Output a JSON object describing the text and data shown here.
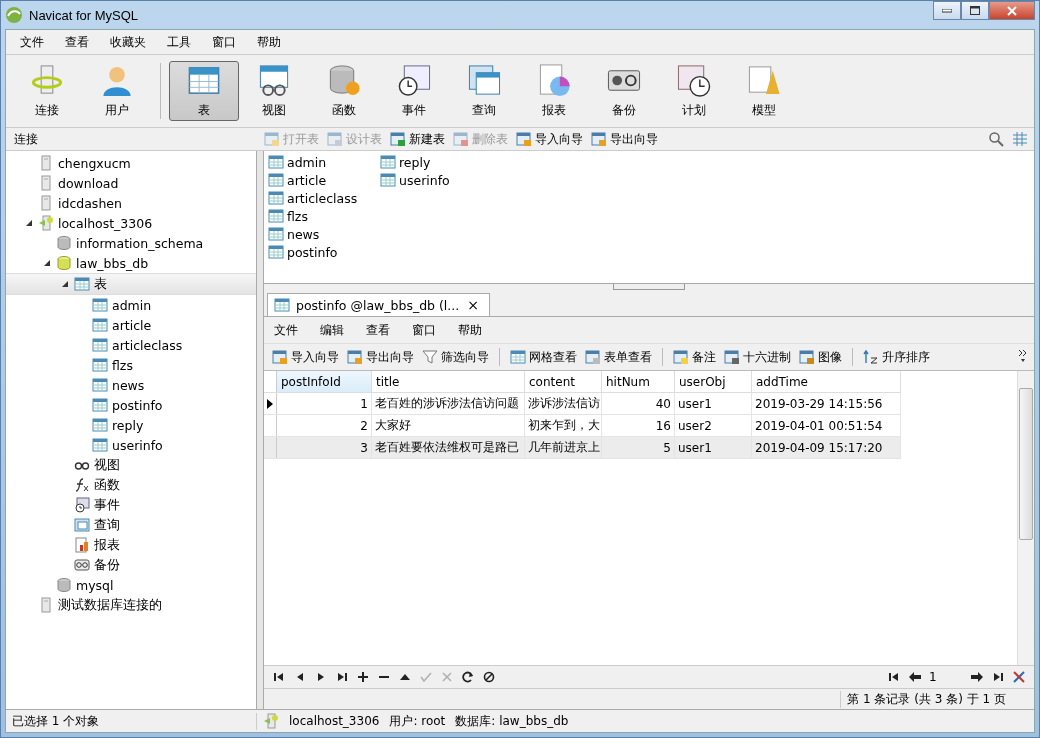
{
  "window": {
    "title": "Navicat for MySQL"
  },
  "menu": [
    "文件",
    "查看",
    "收藏夹",
    "工具",
    "窗口",
    "帮助"
  ],
  "toolbar": [
    {
      "kind": "connection",
      "label": "连接",
      "selected": false
    },
    {
      "kind": "user",
      "label": "用户",
      "selected": false
    },
    {
      "kind": "table",
      "label": "表",
      "selected": true
    },
    {
      "kind": "view",
      "label": "视图",
      "selected": false
    },
    {
      "kind": "function",
      "label": "函数",
      "selected": false
    },
    {
      "kind": "event",
      "label": "事件",
      "selected": false
    },
    {
      "kind": "query",
      "label": "查询",
      "selected": false
    },
    {
      "kind": "report",
      "label": "报表",
      "selected": false
    },
    {
      "kind": "backup",
      "label": "备份",
      "selected": false
    },
    {
      "kind": "schedule",
      "label": "计划",
      "selected": false
    },
    {
      "kind": "model",
      "label": "模型",
      "selected": false
    }
  ],
  "pane_label": "连接",
  "object_actions": [
    {
      "kind": "open",
      "label": "打开表",
      "disabled": true
    },
    {
      "kind": "design",
      "label": "设计表",
      "disabled": true
    },
    {
      "kind": "new",
      "label": "新建表",
      "disabled": false
    },
    {
      "kind": "delete",
      "label": "删除表",
      "disabled": true
    },
    {
      "kind": "import",
      "label": "导入向导",
      "disabled": false
    },
    {
      "kind": "export",
      "label": "导出向导",
      "disabled": false
    }
  ],
  "tree": [
    {
      "kind": "connection",
      "label": "chengxucm",
      "selected": false
    },
    {
      "kind": "connection",
      "label": "download",
      "selected": false
    },
    {
      "kind": "connection",
      "label": "idcdashen",
      "selected": false
    },
    {
      "kind": "connection-open",
      "label": "localhost_3306",
      "expanded": true,
      "selected": false,
      "children": [
        {
          "kind": "schema",
          "label": "information_schema",
          "selected": false
        },
        {
          "kind": "db-open",
          "label": "law_bbs_db",
          "expanded": true,
          "selected": false,
          "children": [
            {
              "kind": "table-folder",
              "label": "表",
              "expanded": true,
              "selected": true,
              "children": [
                {
                  "kind": "table",
                  "label": "admin",
                  "selected": false
                },
                {
                  "kind": "table",
                  "label": "article",
                  "selected": false
                },
                {
                  "kind": "table",
                  "label": "articleclass",
                  "selected": false
                },
                {
                  "kind": "table",
                  "label": "flzs",
                  "selected": false
                },
                {
                  "kind": "table",
                  "label": "news",
                  "selected": false
                },
                {
                  "kind": "table",
                  "label": "postinfo",
                  "selected": false
                },
                {
                  "kind": "table",
                  "label": "reply",
                  "selected": false
                },
                {
                  "kind": "table",
                  "label": "userinfo",
                  "selected": false
                }
              ]
            },
            {
              "kind": "view",
              "label": "视图",
              "selected": false
            },
            {
              "kind": "function",
              "label": "函数",
              "selected": false
            },
            {
              "kind": "event",
              "label": "事件",
              "selected": false
            },
            {
              "kind": "query",
              "label": "查询",
              "selected": false
            },
            {
              "kind": "report",
              "label": "报表",
              "selected": false
            },
            {
              "kind": "backup",
              "label": "备份",
              "selected": false
            }
          ]
        },
        {
          "kind": "schema",
          "label": "mysql",
          "selected": false
        }
      ]
    },
    {
      "kind": "connection",
      "label": "测试数据库连接的",
      "selected": false
    }
  ],
  "objects": [
    "admin",
    "article",
    "articleclass",
    "flzs",
    "news",
    "postinfo",
    "reply",
    "userinfo"
  ],
  "editor_tab": {
    "title": "postinfo @law_bbs_db (l...",
    "close": "×"
  },
  "editor_menu": [
    "文件",
    "编辑",
    "查看",
    "窗口",
    "帮助"
  ],
  "editor_toolbar": [
    {
      "kind": "import",
      "label": "导入向导"
    },
    {
      "kind": "export",
      "label": "导出向导"
    },
    {
      "kind": "filter",
      "label": "筛选向导"
    },
    {
      "kind": "separator"
    },
    {
      "kind": "grid",
      "label": "网格查看"
    },
    {
      "kind": "form",
      "label": "表单查看"
    },
    {
      "kind": "separator"
    },
    {
      "kind": "memo",
      "label": "备注"
    },
    {
      "kind": "hex",
      "label": "十六进制"
    },
    {
      "kind": "image",
      "label": "图像"
    },
    {
      "kind": "separator"
    },
    {
      "kind": "sort",
      "label": "升序排序"
    }
  ],
  "table": {
    "columns": [
      {
        "label": "postInfoId",
        "kind": "number",
        "selected": true
      },
      {
        "label": "title",
        "kind": "text",
        "selected": false
      },
      {
        "label": "content",
        "kind": "text",
        "selected": false
      },
      {
        "label": "hitNum",
        "kind": "number",
        "selected": false
      },
      {
        "label": "userObj",
        "kind": "text",
        "selected": false
      },
      {
        "label": "addTime",
        "kind": "text",
        "selected": false
      }
    ],
    "rows": [
      {
        "current": true,
        "selected": false,
        "cells": [
          "1",
          "老百姓的涉诉涉法信访问题",
          "涉诉涉法信访",
          "40",
          "user1",
          "2019-03-29 14:15:56"
        ]
      },
      {
        "current": false,
        "selected": false,
        "cells": [
          "2",
          "大家好",
          "初来乍到，大",
          "16",
          "user2",
          "2019-04-01 00:51:54"
        ]
      },
      {
        "current": false,
        "selected": true,
        "cells": [
          "3",
          "老百姓要依法维权可是路已",
          "几年前进京上",
          "5",
          "user1",
          "2019-04-09 15:17:20"
        ]
      }
    ]
  },
  "record_nav": [
    {
      "kind": "first",
      "disabled": false
    },
    {
      "kind": "prev",
      "disabled": false
    },
    {
      "kind": "next",
      "disabled": false
    },
    {
      "kind": "last",
      "disabled": false
    },
    {
      "kind": "add",
      "disabled": false
    },
    {
      "kind": "delete",
      "disabled": false
    },
    {
      "kind": "up",
      "disabled": false
    },
    {
      "kind": "apply",
      "disabled": true
    },
    {
      "kind": "cancel",
      "disabled": true
    },
    {
      "kind": "refresh",
      "disabled": false
    },
    {
      "kind": "stop",
      "disabled": false
    }
  ],
  "page_field": "1",
  "page_info": "第 1 条记录 (共 3 条) 于 1 页",
  "status_bar": {
    "selection": "已选择 1 个对象",
    "connection": "localhost_3306",
    "user": "用户: root",
    "database": "数据库: law_bbs_db"
  }
}
